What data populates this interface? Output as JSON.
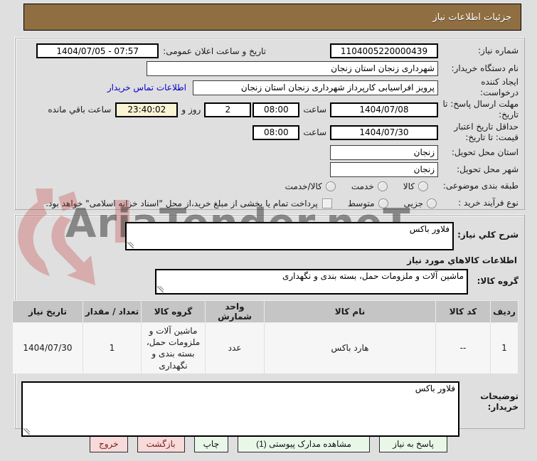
{
  "title_bar": "جزئیات اطلاعات نیاز",
  "fields": {
    "need_number": {
      "label": "شماره نیاز:",
      "value": "1104005220000439"
    },
    "announce": {
      "label": "تاریخ و ساعت اعلان عمومی:",
      "value": "1404/07/05 - 07:57"
    },
    "buyer_org": {
      "label": "نام دستگاه خریدار:",
      "value": "شهرداری زنجان استان زنجان"
    },
    "creator": {
      "label": "ایجاد کننده درخواست:",
      "value": "پرویز افراسیابی کارپرداز شهرداری زنجان استان زنجان",
      "contact_link": "اطلاعات تماس خریدار"
    },
    "deadline": {
      "label": "مهلت ارسال پاسخ: تا تاریخ:",
      "date": "1404/07/08",
      "hour_label": "ساعت",
      "hour": "08:00",
      "days": "2",
      "days_label": "روز و",
      "countdown": "23:40:02",
      "remaining_label": "ساعت باقي مانده"
    },
    "validity": {
      "label": "حداقل تاریخ اعتبار قیمت: تا تاریخ:",
      "date": "1404/07/30",
      "hour_label": "ساعت",
      "hour": "08:00"
    },
    "province": {
      "label": "استان محل تحویل:",
      "value": "زنجان"
    },
    "city": {
      "label": "شهر محل تحویل:",
      "value": "زنجان"
    },
    "subject_class": {
      "label": "طبقه بندی موضوعی:",
      "option_goods": "کالا",
      "option_service": "خدمت",
      "option_both": "کالا/خدمت"
    },
    "process": {
      "label": "نوع فرآیند خرید :",
      "option_minor": "جزیی",
      "option_medium": "متوسط",
      "treasury_note": "پرداخت تمام یا بخشی از مبلغ خرید،از محل \"اسناد خزانه اسلامی\" خواهد بود."
    }
  },
  "need_desc": {
    "label": "شرح کلي نیاز:",
    "value": "فلاور باکس"
  },
  "goods": {
    "section_header": "اطلاعات کالاهاي مورد نیاز",
    "group_label": "گروه کالا:",
    "group_value": "ماشین آلات و ملزومات حمل، بسته بندی و نگهداری",
    "table": {
      "headers": [
        "ردیف",
        "کد کالا",
        "نام کالا",
        "واحد شمارش",
        "گروه کالا",
        "تعداد / مقدار",
        "تاریخ نیاز"
      ],
      "rows": [
        [
          "1",
          "--",
          "هارد باکس",
          "عدد",
          "ماشین آلات و ملزومات حمل، بسته بندی و نگهداری",
          "1",
          "1404/07/30"
        ]
      ]
    }
  },
  "notes": {
    "label": "توضیحات خریدار:",
    "value": "فلاور باکس"
  },
  "actions": {
    "reply": "پاسخ به نیاز",
    "attachments": "مشاهده مدارک پیوستی (1)",
    "print": "چاپ",
    "back": "بازگشت",
    "exit": "خروج"
  },
  "watermark": "AriaTender.neT",
  "colors": {
    "header_brown": "#8F6E42",
    "countdown_bg": "#FBF3D5",
    "button_green": "#E9F7E9",
    "button_pink": "#F7DADA",
    "link_blue": "#0000CC",
    "table_header_bg": "#C5C5C5"
  }
}
